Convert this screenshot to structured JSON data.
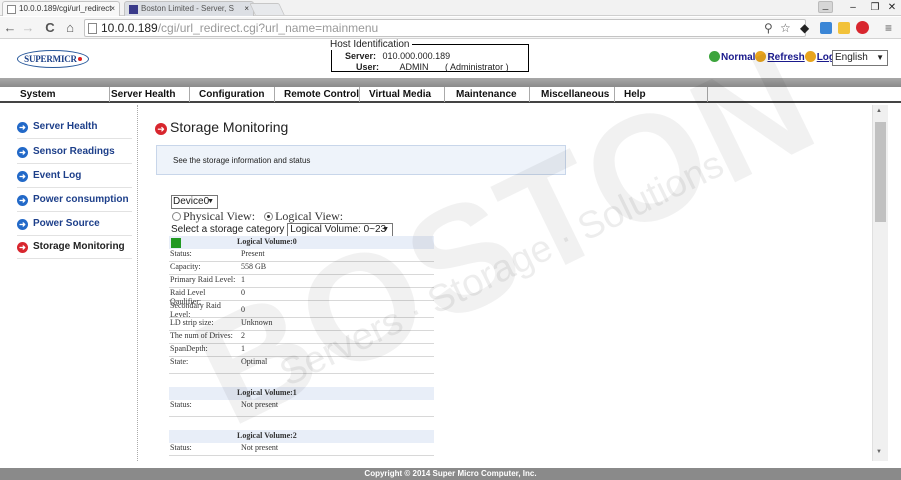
{
  "browser": {
    "tabs": [
      {
        "label": "10.0.0.189/cgi/url_redirect",
        "close": "×"
      },
      {
        "label": "Boston Limited - Server, S",
        "close": "×"
      }
    ],
    "window_controls": {
      "minimize": "–",
      "maximize": "❐",
      "close": "✕"
    },
    "user_badge": "⚊",
    "url_host": "10.0.0.189",
    "url_path": "/cgi/url_redirect.cgi?url_name=mainmenu"
  },
  "header": {
    "logo_text": "SUPERMICR",
    "host_identification": {
      "legend": "Host Identification",
      "server_label": "Server:",
      "server_value": "010.000.000.189",
      "user_label": "User:",
      "user_value": "ADMIN",
      "user_role": "( Administrator )"
    },
    "status": {
      "normal": "Normal",
      "refresh": "Refresh",
      "logout": "Logout"
    },
    "language": "English"
  },
  "menu": [
    "System",
    "Server Health",
    "Configuration",
    "Remote Control",
    "Virtual Media",
    "Maintenance",
    "Miscellaneous",
    "Help"
  ],
  "sidebar": {
    "items": [
      {
        "label": "Server Health",
        "active": false
      },
      {
        "label": "Sensor Readings",
        "active": false
      },
      {
        "label": "Event Log",
        "active": false
      },
      {
        "label": "Power consumption",
        "active": false
      },
      {
        "label": "Power Source",
        "active": false
      },
      {
        "label": "Storage Monitoring",
        "active": true
      }
    ]
  },
  "main": {
    "title": "Storage Monitoring",
    "info": "See the storage information and status",
    "device": "Device0",
    "physical_view": "Physical View:",
    "logical_view": "Logical View:",
    "view_selected": "logical",
    "category_label": "Select a storage category",
    "category_value": "Logical Volume: 0~23",
    "volumes": [
      {
        "title": "Logical Volume:0",
        "status_color": "#229922",
        "rows": [
          {
            "k": "Status:",
            "v": "Present"
          },
          {
            "k": "Capacity:",
            "v": "558 GB"
          },
          {
            "k": "Primary Raid Level:",
            "v": "1"
          },
          {
            "k": "Raid Level Qaulifier:",
            "v": "0"
          },
          {
            "k": "Secondary Raid Level:",
            "v": "0",
            "tall": true
          },
          {
            "k": "LD strip size:",
            "v": "Unknown"
          },
          {
            "k": "The num of Drives:",
            "v": "2"
          },
          {
            "k": "SpanDepth:",
            "v": "1"
          },
          {
            "k": "State:",
            "v": "Optimal",
            "tall": true
          }
        ]
      },
      {
        "title": "Logical Volume:1",
        "rows": [
          {
            "k": "Status:",
            "v": "Not present",
            "tall": true
          }
        ]
      },
      {
        "title": "Logical Volume:2",
        "rows": [
          {
            "k": "Status:",
            "v": "Not present"
          }
        ]
      }
    ]
  },
  "footer": "Copyright © 2014 Super Micro Computer, Inc.",
  "watermark": {
    "brand": "BOSTON",
    "tagline": "Servers · Storage · Solutions"
  }
}
